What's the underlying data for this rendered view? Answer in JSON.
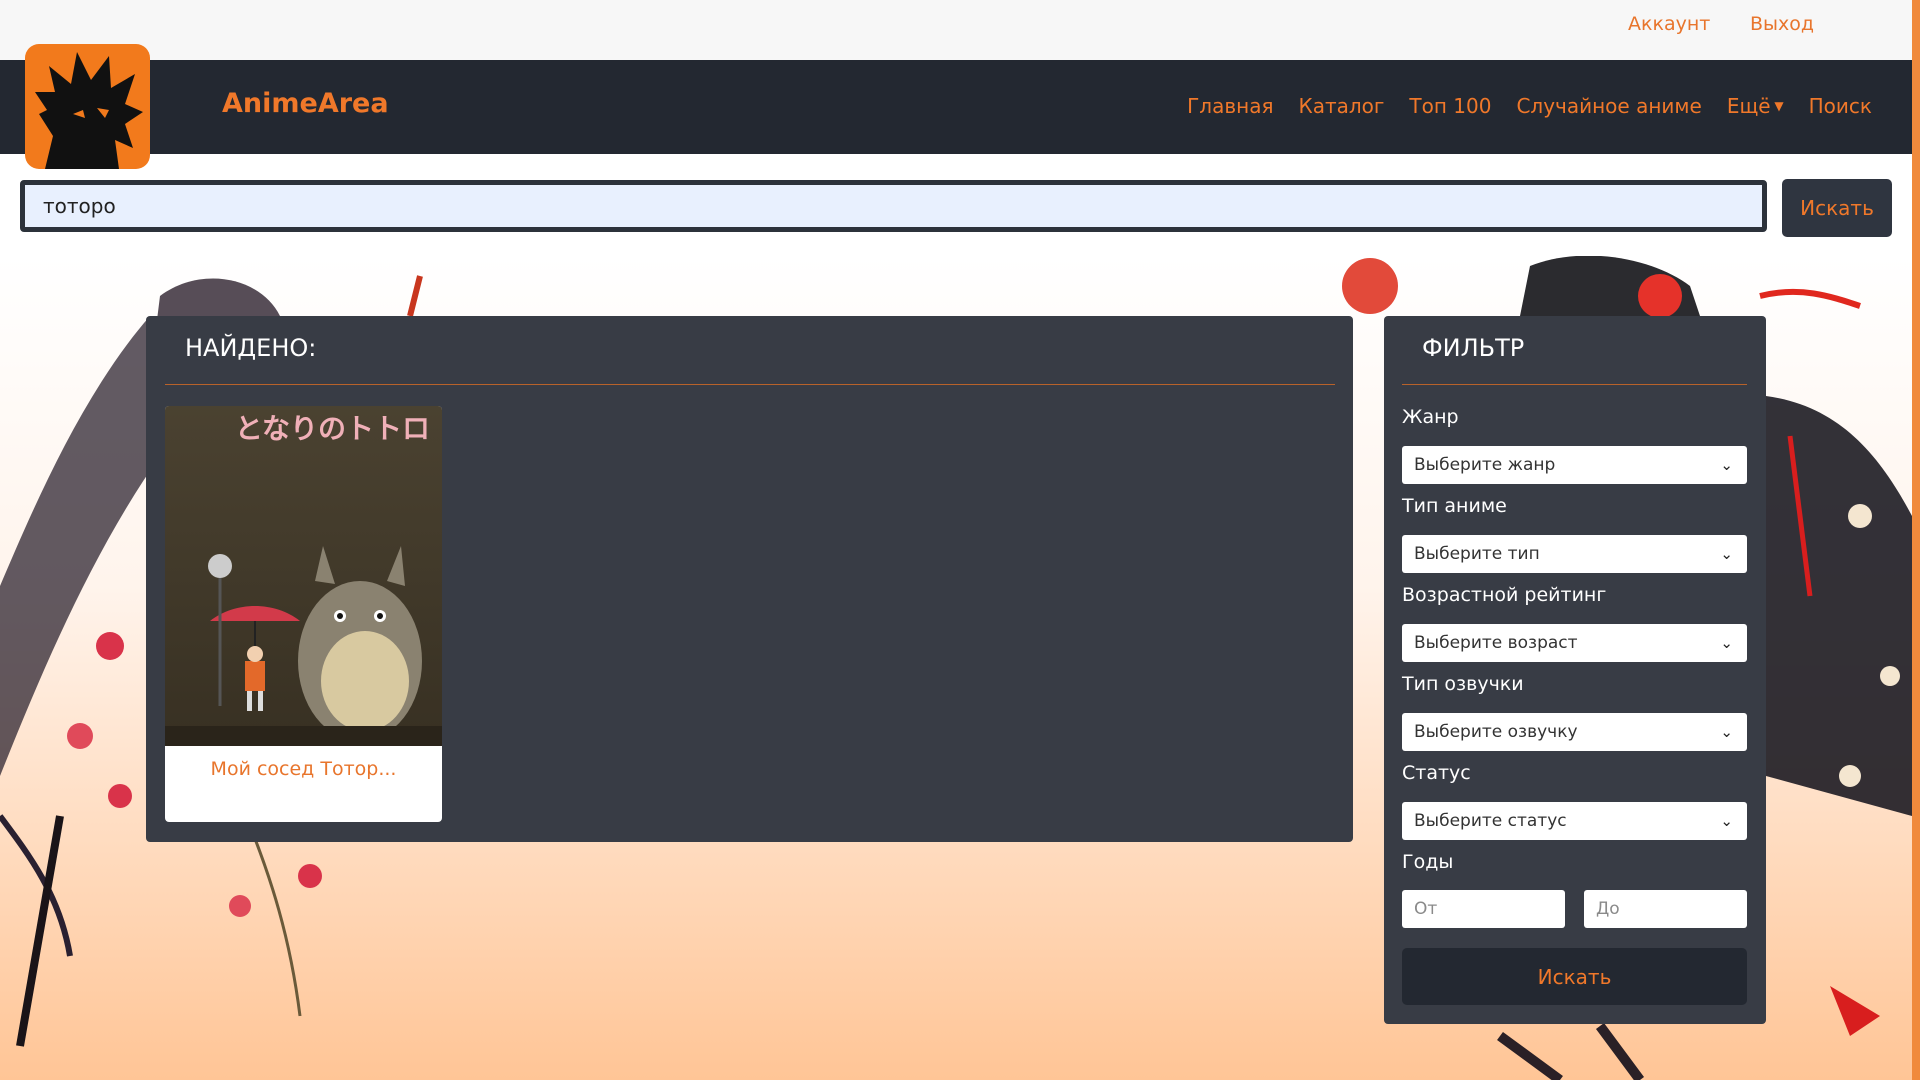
{
  "topbar": {
    "account": "Аккаунт",
    "logout": "Выход"
  },
  "navbar": {
    "brand": "AnimeArea",
    "links": [
      "Главная",
      "Каталог",
      "Топ 100",
      "Случайное аниме",
      "Ещё",
      "Поиск"
    ]
  },
  "search": {
    "value": "тоторо",
    "button": "Искать"
  },
  "results": {
    "title": "НАЙДЕНО:",
    "items": [
      {
        "title": "Мой сосед Тотор...",
        "poster_text": "となりのトトロ"
      }
    ]
  },
  "filter": {
    "title": "ФИЛЬТР",
    "genre": {
      "label": "Жанр",
      "value": "Выберите жанр"
    },
    "type": {
      "label": "Тип аниме",
      "value": "Выберите тип"
    },
    "age": {
      "label": "Возрастной рейтинг",
      "value": "Выберите возраст"
    },
    "voice": {
      "label": "Тип озвучки",
      "value": "Выберите озвучку"
    },
    "status": {
      "label": "Статус",
      "value": "Выберите статус"
    },
    "years": {
      "label": "Годы",
      "from_placeholder": "От",
      "to_placeholder": "До"
    },
    "button": "Искать"
  },
  "colors": {
    "accent": "#f0782a",
    "navbar": "#232831",
    "panel": "#383c45"
  }
}
